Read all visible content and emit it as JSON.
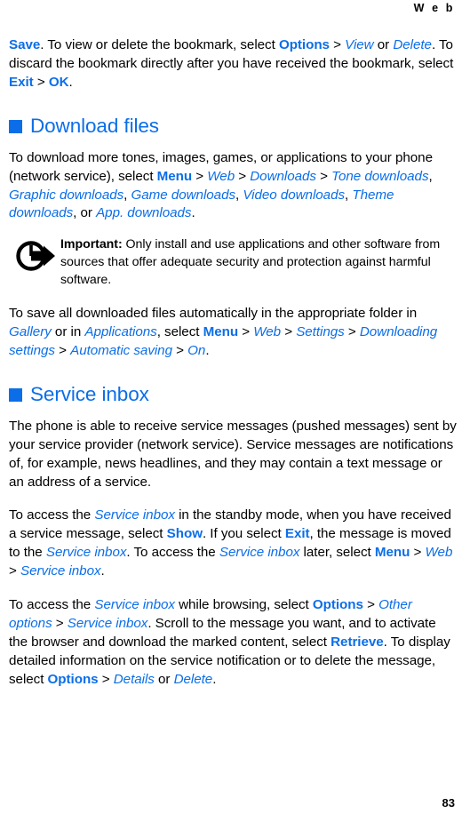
{
  "header": {
    "running_head": "W e b"
  },
  "footer": {
    "page_number": "83"
  },
  "colors": {
    "accent_blue": "#0b6ee8",
    "text_black": "#000000",
    "background": "#ffffff"
  },
  "paragraphs": {
    "bookmark_save": {
      "r1": "Save",
      "r2": ". To view or delete the bookmark, select ",
      "r3": "Options",
      "r4": " > ",
      "r5": "View",
      "r6": " or ",
      "r7": "Delete",
      "r8": ". To discard the bookmark directly after you have received the bookmark, select ",
      "r9": "Exit",
      "r10": " > ",
      "r11": "OK",
      "r12": "."
    },
    "download_intro": {
      "r1": "To download more tones, images, games, or applications to your phone (network service), select ",
      "r2": "Menu",
      "r3": " > ",
      "r4": "Web",
      "r5": " > ",
      "r6": "Downloads",
      "r7": " > ",
      "r8": "Tone downloads",
      "r9": ", ",
      "r10": "Graphic downloads",
      "r11": ", ",
      "r12": "Game downloads",
      "r13": ", ",
      "r14": "Video downloads",
      "r15": ", ",
      "r16": "Theme downloads",
      "r17": ", or ",
      "r18": "App. downloads",
      "r19": "."
    },
    "important_note": {
      "label": "Important:",
      "text": " Only install and use applications and other software from sources that offer adequate security and protection against harmful software."
    },
    "auto_save": {
      "r1": "To save all downloaded files automatically in the appropriate folder in ",
      "r2": "Gallery",
      "r3": " or in ",
      "r4": "Applications",
      "r5": ", select ",
      "r6": "Menu",
      "r7": " > ",
      "r8": "Web",
      "r9": " > ",
      "r10": "Settings",
      "r11": " > ",
      "r12": "Downloading settings",
      "r13": " > ",
      "r14": "Automatic saving",
      "r15": " > ",
      "r16": "On",
      "r17": "."
    },
    "service_intro": {
      "text": "The phone is able to receive service messages (pushed messages) sent by your service provider (network service). Service messages are notifications of, for example, news headlines, and they may contain a text message or an address of a service."
    },
    "standby_access": {
      "r1": "To access the ",
      "r2": "Service inbox",
      "r3": " in the standby mode, when you have received a service message, select ",
      "r4": "Show",
      "r5": ". If you select ",
      "r6": "Exit",
      "r7": ", the message is moved to the ",
      "r8": "Service inbox",
      "r9": ". To access the ",
      "r10": "Service inbox",
      "r11": " later, select ",
      "r12": "Menu",
      "r13": " > ",
      "r14": "Web",
      "r15": " > ",
      "r16": "Service inbox",
      "r17": "."
    },
    "browsing_access": {
      "r1": "To access the ",
      "r2": "Service inbox",
      "r3": " while browsing, select ",
      "r4": "Options",
      "r5": " > ",
      "r6": "Other options",
      "r7": " > ",
      "r8": "Service inbox",
      "r9": ". Scroll to the message you want, and to activate the browser and download the marked content, select ",
      "r10": "Retrieve",
      "r11": ". To display detailed information on the service notification or to delete the message, select ",
      "r12": "Options",
      "r13": " > ",
      "r14": "Details",
      "r15": " or ",
      "r16": "Delete",
      "r17": "."
    }
  },
  "headings": {
    "download_files": "Download files",
    "service_inbox": "Service inbox"
  }
}
